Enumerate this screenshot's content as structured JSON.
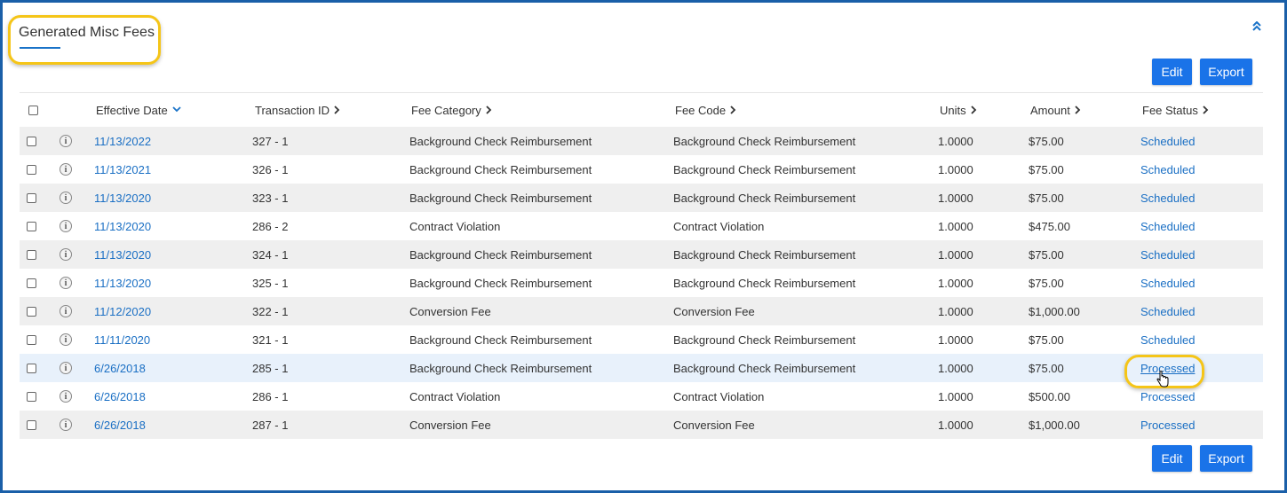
{
  "panel": {
    "title": "Generated Misc Fees",
    "collapse_icon": "double-chevron-up-icon"
  },
  "toolbar": {
    "edit_label": "Edit",
    "export_label": "Export"
  },
  "table": {
    "headers": {
      "effective_date": "Effective Date",
      "transaction_id": "Transaction ID",
      "fee_category": "Fee Category",
      "fee_code": "Fee Code",
      "units": "Units",
      "amount": "Amount",
      "fee_status": "Fee Status"
    },
    "rows": [
      {
        "date": "11/13/2022",
        "txn": "327 - 1",
        "category": "Background Check Reimbursement",
        "code": "Background Check Reimbursement",
        "units": "1.0000",
        "amount": "$75.00",
        "status": "Scheduled"
      },
      {
        "date": "11/13/2021",
        "txn": "326 - 1",
        "category": "Background Check Reimbursement",
        "code": "Background Check Reimbursement",
        "units": "1.0000",
        "amount": "$75.00",
        "status": "Scheduled"
      },
      {
        "date": "11/13/2020",
        "txn": "323 - 1",
        "category": "Background Check Reimbursement",
        "code": "Background Check Reimbursement",
        "units": "1.0000",
        "amount": "$75.00",
        "status": "Scheduled"
      },
      {
        "date": "11/13/2020",
        "txn": "286 - 2",
        "category": "Contract Violation",
        "code": "Contract Violation",
        "units": "1.0000",
        "amount": "$475.00",
        "status": "Scheduled"
      },
      {
        "date": "11/13/2020",
        "txn": "324 - 1",
        "category": "Background Check Reimbursement",
        "code": "Background Check Reimbursement",
        "units": "1.0000",
        "amount": "$75.00",
        "status": "Scheduled"
      },
      {
        "date": "11/13/2020",
        "txn": "325 - 1",
        "category": "Background Check Reimbursement",
        "code": "Background Check Reimbursement",
        "units": "1.0000",
        "amount": "$75.00",
        "status": "Scheduled"
      },
      {
        "date": "11/12/2020",
        "txn": "322 - 1",
        "category": "Conversion Fee",
        "code": "Conversion Fee",
        "units": "1.0000",
        "amount": "$1,000.00",
        "status": "Scheduled"
      },
      {
        "date": "11/11/2020",
        "txn": "321 - 1",
        "category": "Background Check Reimbursement",
        "code": "Background Check Reimbursement",
        "units": "1.0000",
        "amount": "$75.00",
        "status": "Scheduled"
      },
      {
        "date": "6/26/2018",
        "txn": "285 - 1",
        "category": "Background Check Reimbursement",
        "code": "Background Check Reimbursement",
        "units": "1.0000",
        "amount": "$75.00",
        "status": "Processed"
      },
      {
        "date": "6/26/2018",
        "txn": "286 - 1",
        "category": "Contract Violation",
        "code": "Contract Violation",
        "units": "1.0000",
        "amount": "$500.00",
        "status": "Processed"
      },
      {
        "date": "6/26/2018",
        "txn": "287 - 1",
        "category": "Conversion Fee",
        "code": "Conversion Fee",
        "units": "1.0000",
        "amount": "$1,000.00",
        "status": "Processed"
      }
    ],
    "hovered_row": 8
  },
  "colors": {
    "accent": "#1a73e8",
    "link": "#1a6fc4",
    "highlight": "#f5c518",
    "border": "#1a5fa8",
    "row_alt": "#efefef"
  }
}
